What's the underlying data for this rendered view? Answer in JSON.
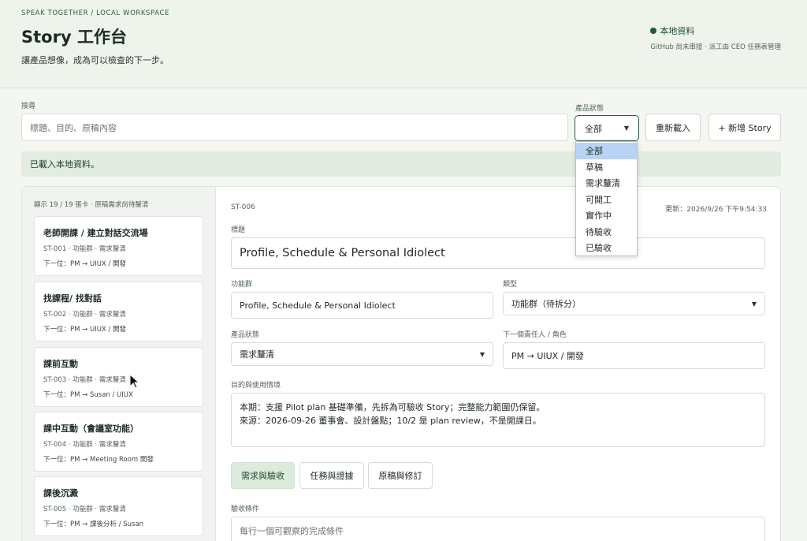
{
  "header": {
    "eyebrow": "SPEAK TOGETHER / LOCAL WORKSPACE",
    "title": "Story 工作台",
    "tagline": "讓產品想像，成為可以檢查的下一步。",
    "status": "本地資料",
    "status_sub": "GitHub 尚未串接 · 派工由 CEO 任務表管理"
  },
  "filters": {
    "search_label": "搜尋",
    "search_placeholder": "標題、目的、原稿內容",
    "status_label": "產品狀態",
    "status_value": "全部",
    "reload_label": "重新載入",
    "add_label": "+ 新增 Story",
    "status_options": [
      "全部",
      "草稿",
      "需求釐清",
      "可開工",
      "實作中",
      "待驗收",
      "已驗收"
    ]
  },
  "banner": "已載入本地資料。",
  "list": {
    "summary": "顯示 19 / 19 張卡 · 原稿需求尚待釐清",
    "cards": [
      {
        "title": "老師開課 / 建立對話交流場",
        "meta": "ST-001 · 功能群 · 需求釐清",
        "next": "下一位：PM → UIUX / 開發"
      },
      {
        "title": "找課程/ 找對話",
        "meta": "ST-002 · 功能群 · 需求釐清",
        "next": "下一位：PM → UIUX / 開發"
      },
      {
        "title": "課前互動",
        "meta": "ST-003 · 功能群 · 需求釐清",
        "next": "下一位：PM → Susan / UIUX"
      },
      {
        "title": "課中互動（會議室功能）",
        "meta": "ST-004 · 功能群 · 需求釐清",
        "next": "下一位：PM → Meeting Room 開發"
      },
      {
        "title": "課後沉澱",
        "meta": "ST-005 · 功能群 · 需求釐清",
        "next": "下一位：PM → 課後分析 / Susan"
      }
    ]
  },
  "detail": {
    "id": "ST-006",
    "updated": "更新：2026/9/26 下午9:54:33",
    "title_label": "標題",
    "title_value": "Profile, Schedule & Personal Idiolect",
    "group_label": "功能群",
    "group_value": "Profile, Schedule & Personal Idiolect",
    "type_label": "類型",
    "type_value": "功能群（待拆分）",
    "status_label": "產品狀態",
    "status_value": "需求釐清",
    "owner_label": "下一個責任人 / 角色",
    "owner_value": "PM → UIUX / 開發",
    "purpose_label": "目的與使用情境",
    "purpose_line1": "本期：支援 Pilot plan 基礎準備，先拆為可驗收 Story；完整能力範圍仍保留。",
    "purpose_line2": "來源：2026-09-26 董事會、設計盤點；10/2 是 plan review，不是開課日。",
    "tabs": [
      "需求與驗收",
      "任務與證據",
      "原稿與修訂"
    ],
    "acceptance_label": "驗收條件",
    "acceptance_placeholder": "每行一個可觀察的完成條件"
  },
  "colors": {
    "accent": "#1f5a3a",
    "active_tab": "#dcebdc",
    "banner": "#e2ece1"
  }
}
